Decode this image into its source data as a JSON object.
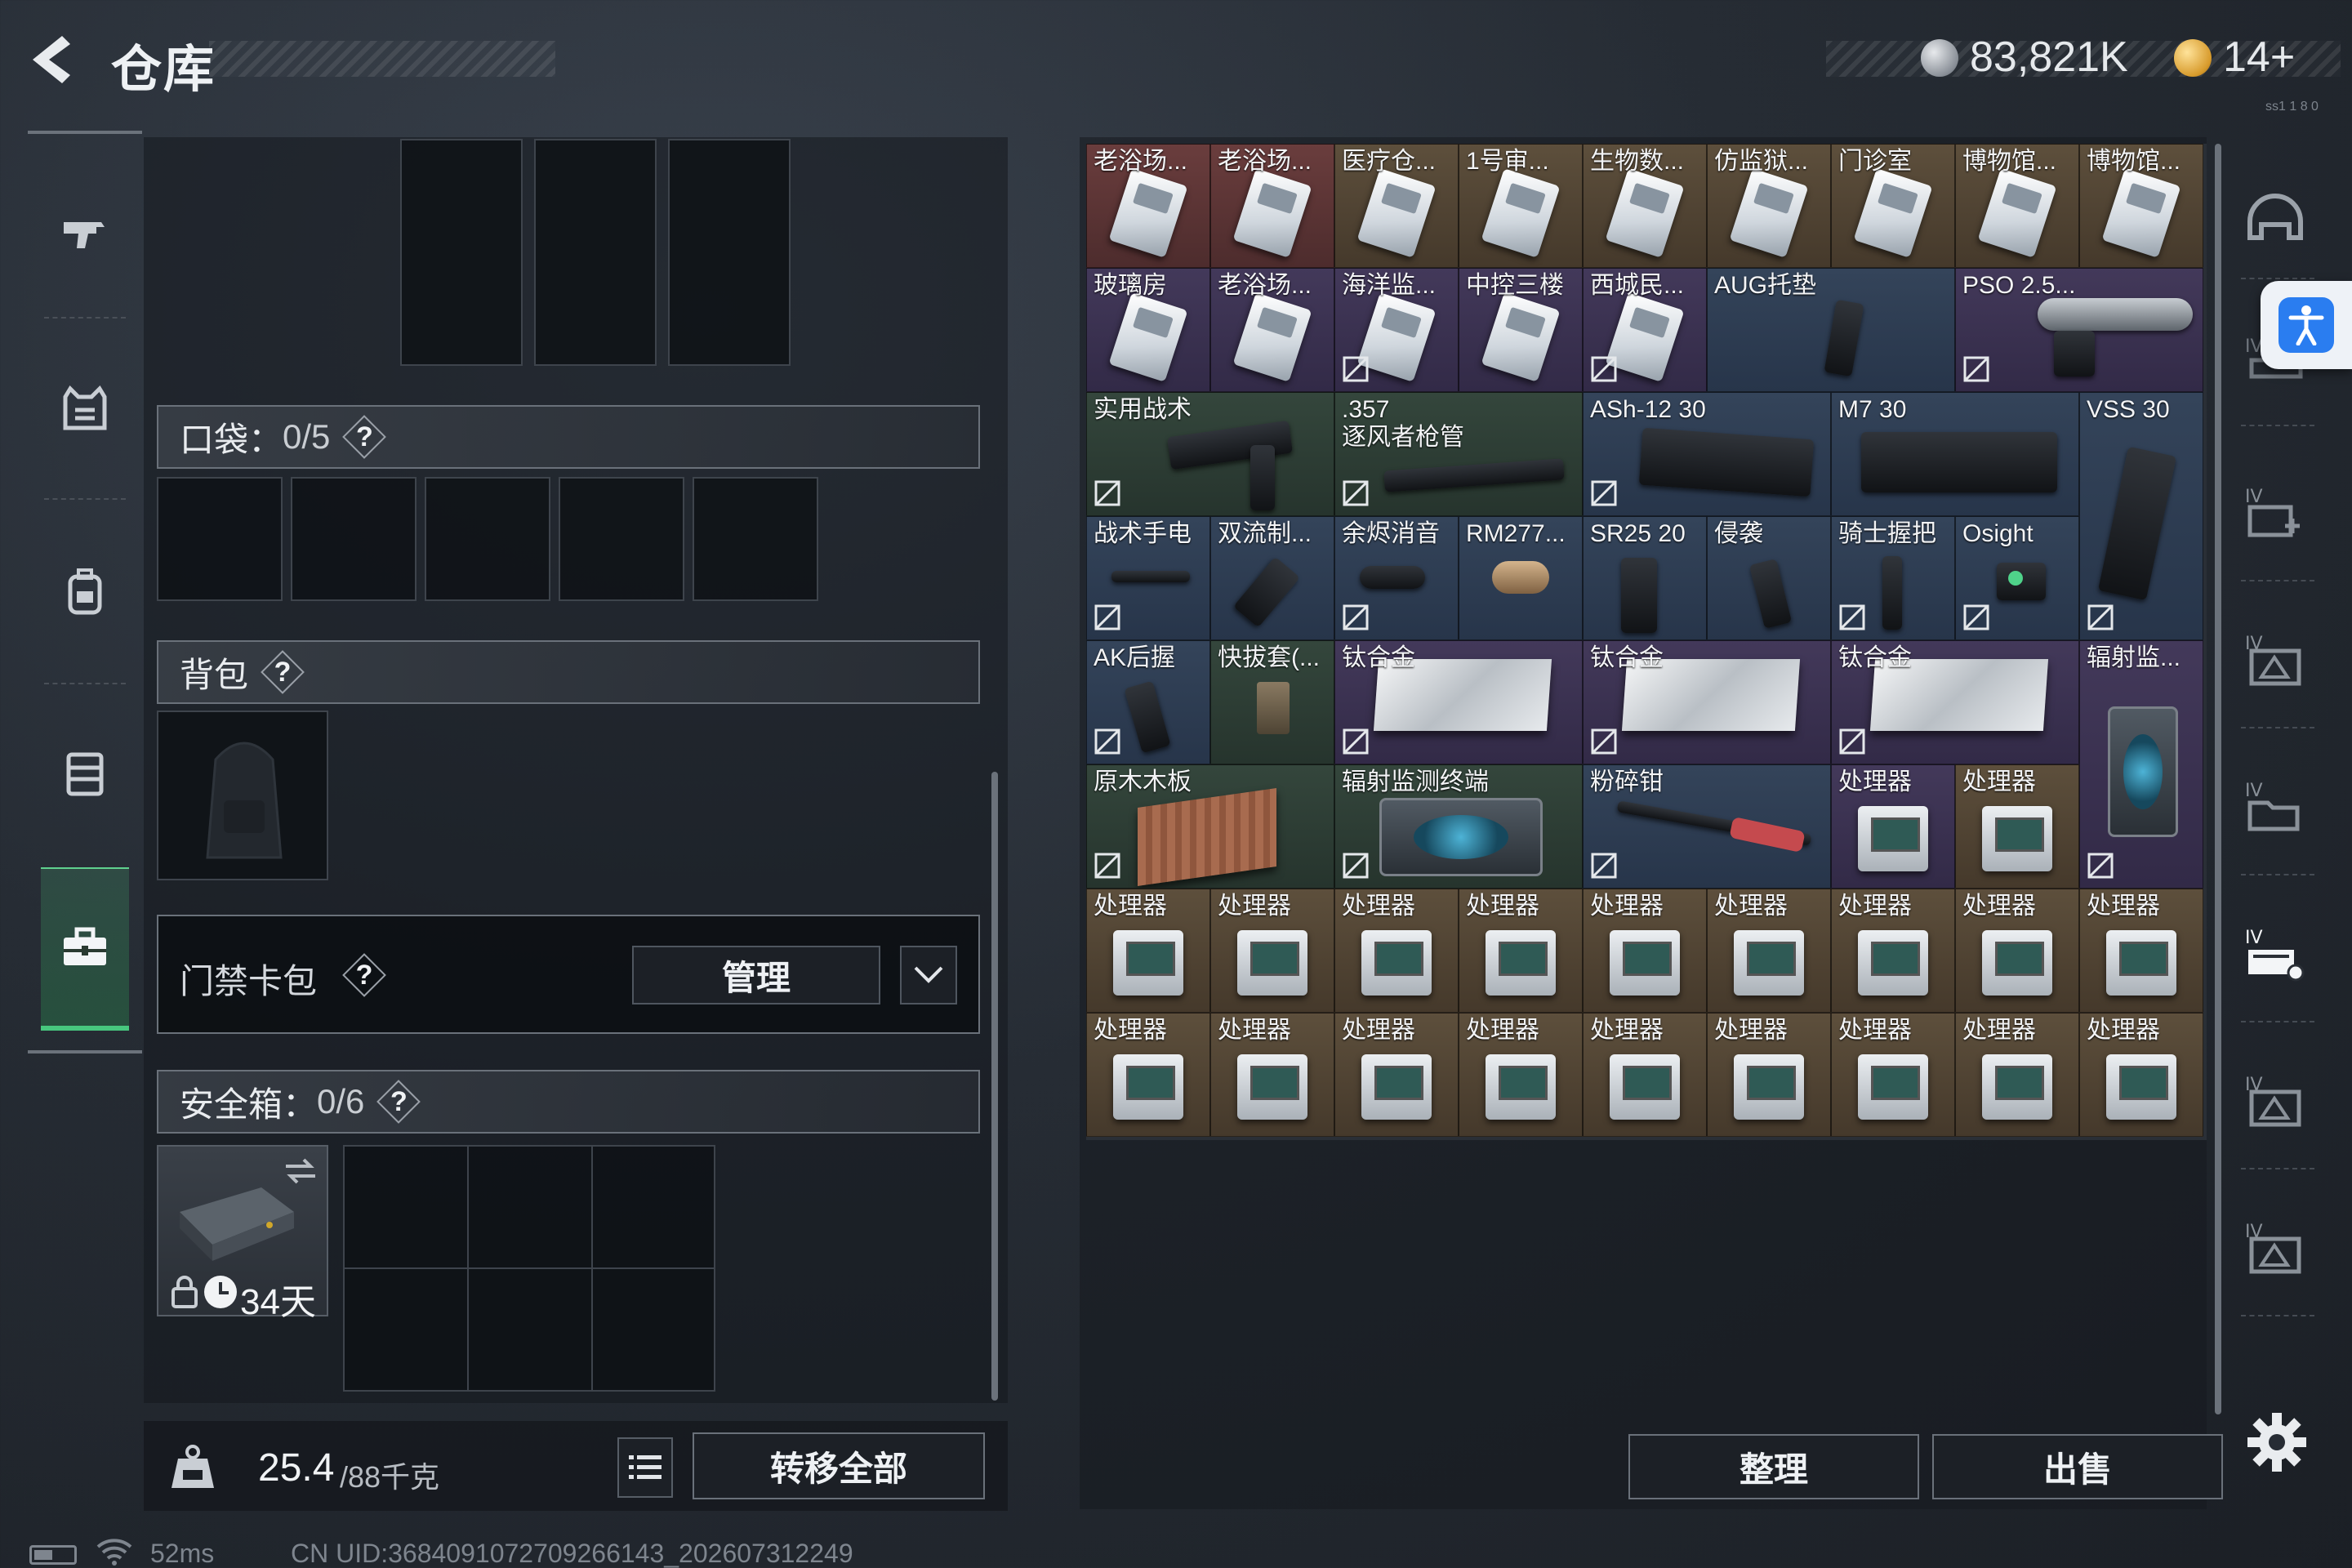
{
  "header": {
    "title": "仓库",
    "currency_value": "83,821K",
    "premium_value": "14+",
    "tiny_code": "ss1 1 8 0"
  },
  "equipment": {
    "pocket": {
      "label": "口袋：",
      "count": "0/5"
    },
    "backpack": {
      "label": "背包"
    },
    "key_card": {
      "label": "门禁卡包",
      "manage_label": "管理"
    },
    "secure_case": {
      "label": "安全箱：",
      "count": "0/6",
      "days_left": "34天"
    },
    "help_symbol": "?"
  },
  "bottom_bar": {
    "weight_current": "25.4",
    "weight_max": "/88千克",
    "transfer_all_label": "转移全部"
  },
  "storage": {
    "sort_label": "整理",
    "sell_label": "出售",
    "items": [
      {
        "name": "老浴场..."
      },
      {
        "name": "老浴场..."
      },
      {
        "name": "医疗仓..."
      },
      {
        "name": "1号审..."
      },
      {
        "name": "生物数..."
      },
      {
        "name": "仿监狱..."
      },
      {
        "name": "门诊室"
      },
      {
        "name": "博物馆..."
      },
      {
        "name": "博物馆..."
      },
      {
        "name": "玻璃房"
      },
      {
        "name": "老浴场..."
      },
      {
        "name": "海洋监..."
      },
      {
        "name": "中控三楼"
      },
      {
        "name": "西城民..."
      },
      {
        "name": "AUG托垫"
      },
      {
        "name": "PSO 2.5..."
      },
      {
        "name": "实用战术"
      },
      {
        "name": ".357\n逐风者枪管"
      },
      {
        "name": "ASh-12 30"
      },
      {
        "name": "M7 30"
      },
      {
        "name": "VSS 30"
      },
      {
        "name": "战术手电"
      },
      {
        "name": "双流制..."
      },
      {
        "name": "余烬消音"
      },
      {
        "name": "RM277..."
      },
      {
        "name": "SR25 20"
      },
      {
        "name": "侵袭"
      },
      {
        "name": "骑士握把"
      },
      {
        "name": "Osight"
      },
      {
        "name": "AK后握"
      },
      {
        "name": "快拔套(..."
      },
      {
        "name": "钛合金"
      },
      {
        "name": "钛合金"
      },
      {
        "name": "钛合金"
      },
      {
        "name": "辐射监..."
      },
      {
        "name": "原木木板"
      },
      {
        "name": "辐射监测终端"
      },
      {
        "name": "粉碎钳"
      },
      {
        "name": "处理器"
      },
      {
        "name": "处理器"
      },
      {
        "name": "处理器"
      },
      {
        "name": "处理器"
      },
      {
        "name": "处理器"
      },
      {
        "name": "处理器"
      },
      {
        "name": "处理器"
      },
      {
        "name": "处理器"
      },
      {
        "name": "处理器"
      },
      {
        "name": "处理器"
      },
      {
        "name": "处理器"
      },
      {
        "name": "处理器"
      },
      {
        "name": "处理器"
      },
      {
        "name": "处理器"
      },
      {
        "name": "处理器"
      },
      {
        "name": "处理器"
      },
      {
        "name": "处理器"
      },
      {
        "name": "处理器"
      },
      {
        "name": "处理器"
      },
      {
        "name": "处理器"
      }
    ]
  },
  "status_bar": {
    "ping": "52ms",
    "uid": "CN UID:3684091072709266143_202607312249"
  },
  "icons": {
    "back": "chevron-left-icon",
    "left_rail": [
      "pistol-icon",
      "armor-vest-icon",
      "backpack-icon",
      "chest-rig-icon",
      "toolbox-icon"
    ],
    "right_rail": [
      "helmet-icon",
      "iv-weapon-icon",
      "iv-medkit-icon",
      "iv-ammo-icon",
      "iv-folder-icon",
      "iv-keycard-icon",
      "iv-ammo-icon",
      "iv-ammo-icon"
    ],
    "settings": "gear-icon",
    "accessibility": "accessibility-icon"
  },
  "colors": {
    "accent_green": "#47c77e",
    "accessibility_blue": "#2a7df0",
    "rarity_red": "#5d3535",
    "rarity_blue": "#2e3d52",
    "rarity_green": "#2e3d34",
    "rarity_purple": "#3a3150",
    "rarity_gold": "#513f30"
  }
}
